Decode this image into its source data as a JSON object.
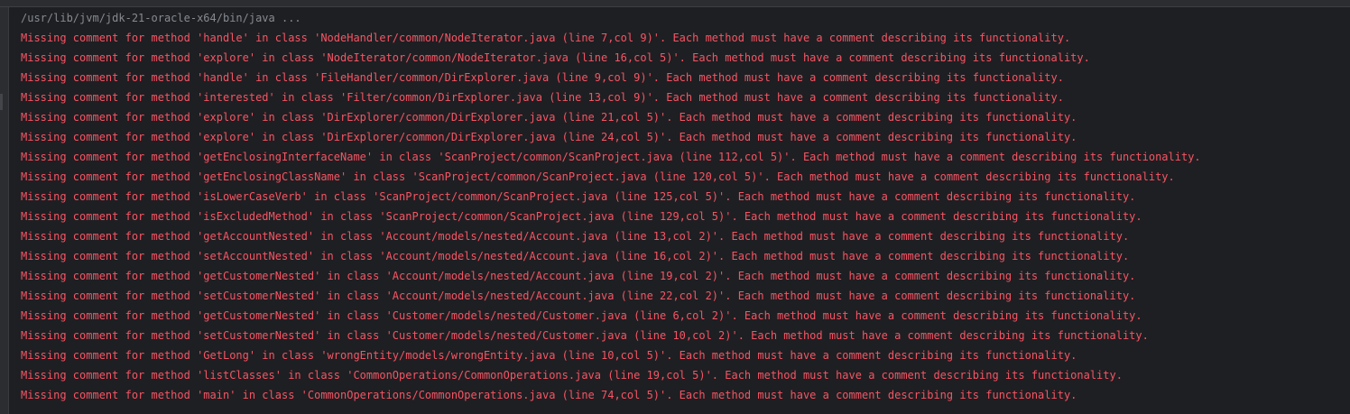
{
  "console": {
    "command": "/usr/lib/jvm/jdk-21-oracle-x64/bin/java ...",
    "lines": [
      "Missing comment for method 'handle' in class 'NodeHandler/common/NodeIterator.java (line 7,col 9)'. Each method must have a comment describing its functionality.",
      "Missing comment for method 'explore' in class 'NodeIterator/common/NodeIterator.java (line 16,col 5)'. Each method must have a comment describing its functionality.",
      "Missing comment for method 'handle' in class 'FileHandler/common/DirExplorer.java (line 9,col 9)'. Each method must have a comment describing its functionality.",
      "Missing comment for method 'interested' in class 'Filter/common/DirExplorer.java (line 13,col 9)'. Each method must have a comment describing its functionality.",
      "Missing comment for method 'explore' in class 'DirExplorer/common/DirExplorer.java (line 21,col 5)'. Each method must have a comment describing its functionality.",
      "Missing comment for method 'explore' in class 'DirExplorer/common/DirExplorer.java (line 24,col 5)'. Each method must have a comment describing its functionality.",
      "Missing comment for method 'getEnclosingInterfaceName' in class 'ScanProject/common/ScanProject.java (line 112,col 5)'. Each method must have a comment describing its functionality.",
      "Missing comment for method 'getEnclosingClassName' in class 'ScanProject/common/ScanProject.java (line 120,col 5)'. Each method must have a comment describing its functionality.",
      "Missing comment for method 'isLowerCaseVerb' in class 'ScanProject/common/ScanProject.java (line 125,col 5)'. Each method must have a comment describing its functionality.",
      "Missing comment for method 'isExcludedMethod' in class 'ScanProject/common/ScanProject.java (line 129,col 5)'. Each method must have a comment describing its functionality.",
      "Missing comment for method 'getAccountNested' in class 'Account/models/nested/Account.java (line 13,col 2)'. Each method must have a comment describing its functionality.",
      "Missing comment for method 'setAccountNested' in class 'Account/models/nested/Account.java (line 16,col 2)'. Each method must have a comment describing its functionality.",
      "Missing comment for method 'getCustomerNested' in class 'Account/models/nested/Account.java (line 19,col 2)'. Each method must have a comment describing its functionality.",
      "Missing comment for method 'setCustomerNested' in class 'Account/models/nested/Account.java (line 22,col 2)'. Each method must have a comment describing its functionality.",
      "Missing comment for method 'getCustomerNested' in class 'Customer/models/nested/Customer.java (line 6,col 2)'. Each method must have a comment describing its functionality.",
      "Missing comment for method 'setCustomerNested' in class 'Customer/models/nested/Customer.java (line 10,col 2)'. Each method must have a comment describing its functionality.",
      "Missing comment for method 'GetLong' in class 'wrongEntity/models/wrongEntity.java (line 10,col 5)'. Each method must have a comment describing its functionality.",
      "Missing comment for method 'listClasses' in class 'CommonOperations/CommonOperations.java (line 19,col 5)'. Each method must have a comment describing its functionality.",
      "Missing comment for method 'main' in class 'CommonOperations/CommonOperations.java (line 74,col 5)'. Each method must have a comment describing its functionality."
    ]
  },
  "colors": {
    "background": "#1e1f22",
    "error_text": "#f75464",
    "command_text": "#868a91"
  }
}
